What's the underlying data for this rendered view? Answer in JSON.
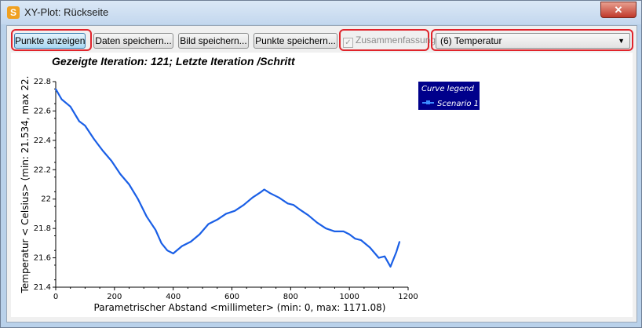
{
  "window": {
    "title": "XY-Plot: Rückseite",
    "close_label": "✕"
  },
  "toolbar": {
    "show_points": "Punkte anzeigen",
    "save_data": "Daten speichern...",
    "save_image": "Bild speichern...",
    "save_points": "Punkte speichern...",
    "summary_label": "Zusammenfassung",
    "summary_checked": true,
    "variable_select": "(6) Temperatur"
  },
  "plot": {
    "title": "Gezeigte Iteration: 121; Letzte Iteration /Schritt"
  },
  "chart_data": {
    "type": "line",
    "title": "Gezeigte Iteration: 121; Letzte Iteration /Schritt",
    "xlabel": "Parametrischer Abstand  <millimeter>  (min: 0, max: 1171.08)",
    "ylabel": "Temperatur < Celsius>  (min: 21.534, max 22.",
    "xlim": [
      0,
      1200
    ],
    "ylim": [
      21.4,
      22.8
    ],
    "xticks": [
      "0",
      "200",
      "400",
      "600",
      "800",
      "1000",
      "1200"
    ],
    "yticks": [
      "21.4",
      "21.6",
      "21.8",
      "22",
      "22.2",
      "22.4",
      "22.6",
      "22.8"
    ],
    "grid": false,
    "legend": {
      "title": "Curve legend",
      "position": "top-right"
    },
    "series": [
      {
        "name": "Scenario 1",
        "color": "#1a5fe6",
        "x": [
          0,
          20,
          50,
          80,
          100,
          130,
          160,
          190,
          220,
          250,
          280,
          310,
          340,
          360,
          380,
          400,
          430,
          460,
          490,
          520,
          550,
          580,
          610,
          640,
          670,
          700,
          710,
          730,
          760,
          790,
          810,
          830,
          860,
          890,
          920,
          950,
          980,
          1000,
          1020,
          1040,
          1070,
          1100,
          1120,
          1140,
          1160,
          1171
        ],
        "y": [
          22.75,
          22.68,
          22.63,
          22.53,
          22.5,
          22.41,
          22.33,
          22.26,
          22.17,
          22.1,
          22.0,
          21.88,
          21.79,
          21.7,
          21.65,
          21.63,
          21.68,
          21.71,
          21.76,
          21.83,
          21.86,
          21.9,
          21.92,
          21.96,
          22.01,
          22.05,
          22.065,
          22.04,
          22.01,
          21.97,
          21.96,
          21.93,
          21.89,
          21.84,
          21.8,
          21.78,
          21.78,
          21.76,
          21.73,
          21.72,
          21.67,
          21.6,
          21.61,
          21.54,
          21.64,
          21.71
        ]
      }
    ]
  }
}
